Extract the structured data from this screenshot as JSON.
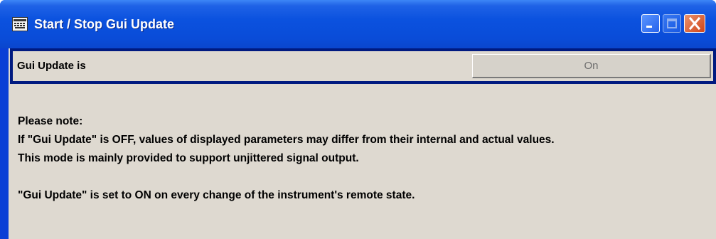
{
  "window": {
    "title": "Start / Stop Gui Update",
    "icon": "keyboard-icon",
    "controls": [
      "minimize-icon",
      "maximize-icon",
      "close-icon"
    ],
    "colors": {
      "titlebar": "#0b52df",
      "frame": "#0a3fd6",
      "panel": "#ded9d0",
      "row_border": "#001a80",
      "close": "#d04418"
    }
  },
  "setting": {
    "label": "Gui Update is",
    "value": "On"
  },
  "notes": {
    "line1": "Please note:",
    "line2": "If \"Gui Update\" is OFF, values of displayed parameters may differ from their internal and actual values.",
    "line3": "This mode is mainly provided to support unjittered signal output.",
    "line4": "\"Gui Update\" is set to ON on every change of the instrument's remote state."
  }
}
